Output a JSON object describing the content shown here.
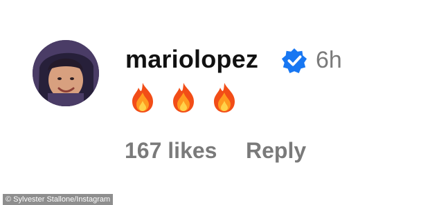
{
  "comment": {
    "avatar_icon": "profile-photo",
    "username": "mariolopez",
    "verified_icon": "verified-badge-icon",
    "timestamp": "6h",
    "emojis": [
      "🔥",
      "🔥",
      "🔥"
    ],
    "likes": "167 likes",
    "reply_label": "Reply"
  },
  "credit": "© Sylvester Stallone/Instagram",
  "colors": {
    "verified_blue": "#1877f2",
    "muted_text": "#7a7a7a",
    "username_text": "#111111"
  }
}
